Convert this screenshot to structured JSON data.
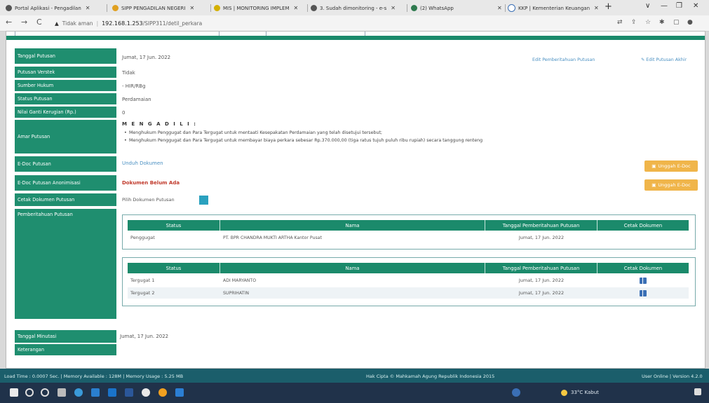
{
  "browser": {
    "tabs": [
      {
        "label": "Portal Aplikasi - Pengadilan",
        "color": "#555555"
      },
      {
        "label": "SIPP PENGADILAN NEGERI",
        "color": "#e0a020"
      },
      {
        "label": "MIS | MONITORING IMPLEM",
        "color": "#d4b000"
      },
      {
        "label": "3. Sudah dimonitoring - e-s",
        "color": "#555555"
      },
      {
        "label": "(2) WhatsApp",
        "color": "#2f7a4f"
      },
      {
        "label": "KKP | Kementerian Keuangan",
        "color": "#3a6fb5"
      }
    ],
    "url_secure_label": "Tidak aman",
    "url_host": "192.168.1.253",
    "url_path": "/SIPP311/detil_perkara"
  },
  "fields": {
    "tanggal_putusan": {
      "label": "Tanggal Putusan",
      "value": "Jumat, 17 Jun. 2022"
    },
    "putusan_verstek": {
      "label": "Putusan Verstek",
      "value": "Tidak"
    },
    "sumber_hukum": {
      "label": "Sumber Hukum",
      "value": "- HIR/RBg"
    },
    "status_putusan": {
      "label": "Status Putusan",
      "value": "Perdamaian"
    },
    "nilai_ganti_kerugian": {
      "label": "Nilai Ganti Kerugian (Rp.)",
      "value": "0"
    },
    "amar_putusan": {
      "label": "Amar Putusan",
      "heading": "M E N G A D I L I :",
      "items": [
        "Menghukum Penggugat dan Para Tergugat untuk mentaati Kesepakatan Perdamaian yang telah disetujui tersebut;",
        "Menghukum Penggugat dan Para Tergugat untuk membayar biaya perkara sebesar Rp.370.000,00 (tiga ratus tujuh puluh ribu rupiah) secara tanggung renteng"
      ]
    },
    "edoc_putusan": {
      "label": "E-Doc Putusan",
      "value": "Unduh Dokumen"
    },
    "edoc_anonimisasi": {
      "label": "E-Doc Putusan Anonimisasi",
      "value": "Dokumen Belum Ada"
    },
    "cetak_dokumen": {
      "label": "Cetak Dokumen Putusan",
      "value": "Pilih Dokumen Putusan"
    },
    "pemberitahuan": {
      "label": "Pemberitahuan Putusan"
    },
    "tanggal_minutasi": {
      "label": "Tanggal Minutasi",
      "value": "Jumat, 17 Jun. 2022"
    },
    "keterangan": {
      "label": "Keterangan"
    }
  },
  "actions": {
    "edit_pemberitahuan": "Edit Pemberitahuan Putusan",
    "edit_putusan_akhir": "Edit Putusan Akhir",
    "unggah_edoc_1": "Unggah E-Doc",
    "unggah_edoc_2": "Unggah E-Doc"
  },
  "table1": {
    "headers": [
      "Status",
      "Nama",
      "Tanggal Pemberitahuan Putusan",
      "Cetak Dokumen"
    ],
    "rows": [
      [
        "Penggugat",
        "PT. BPR CHANDRA MUKTI ARTHA Kantor Pusat",
        "Jumat, 17 Jun. 2022",
        ""
      ]
    ]
  },
  "table2": {
    "headers": [
      "Status",
      "Nama",
      "Tanggal Pemberitahuan Putusan",
      "Cetak Dokumen"
    ],
    "rows": [
      [
        "Tergugat 1",
        "ADI MARYANTO",
        "Jumat, 17 Jun. 2022",
        "print"
      ],
      [
        "Tergugat 2",
        "SUPRIHATIN",
        "Jumat, 17 Jun. 2022",
        "print"
      ]
    ]
  },
  "statusbar": {
    "left": "Load Time : 0.0007 Sec. | Memory Available : 128M | Memory Usage : 5.25 MB",
    "center": "Hak Cipta © Mahkamah Agung Republik Indonesia 2015",
    "right": "User Online | Version 4.2.0"
  },
  "taskbar": {
    "weather": "33°C Kabut"
  },
  "colors": {
    "primary": "#1f8e6f",
    "header": "#1b8a6b",
    "accent_orange": "#f0b54a",
    "danger": "#c0392b",
    "link": "#4a90c2"
  }
}
